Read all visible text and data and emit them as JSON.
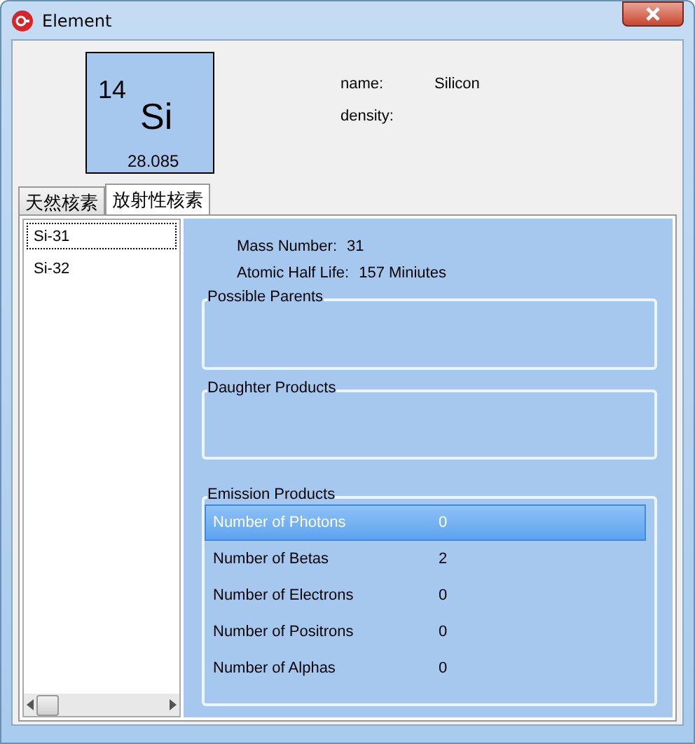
{
  "window": {
    "title": "Element"
  },
  "element": {
    "atomic_number": "14",
    "symbol": "Si",
    "atomic_mass": "28.085"
  },
  "properties": [
    {
      "label": "name:",
      "value": "Silicon"
    },
    {
      "label": "density:"
    }
  ],
  "tabs": [
    {
      "label": "天然核素",
      "selected": false
    },
    {
      "label": "放射性核素",
      "selected": true
    }
  ],
  "isotopes": [
    {
      "label": "Si-31",
      "selected": true
    },
    {
      "label": "Si-32",
      "selected": false
    }
  ],
  "details": [
    {
      "label": "Mass Number:",
      "value": "31"
    },
    {
      "label": "Atomic Half Life:",
      "value": "157 Miniutes"
    }
  ],
  "groups": [
    {
      "title": "Possible Parents"
    },
    {
      "title": "Daughter Products"
    },
    {
      "title": "Emission Products",
      "rows": [
        {
          "label": "Number of Photons",
          "value": "0",
          "selected": true
        },
        {
          "label": "Number of Betas",
          "value": "2",
          "selected": false
        },
        {
          "label": "Number of Electrons",
          "value": "0",
          "selected": false
        },
        {
          "label": "Number of Positrons",
          "value": "0",
          "selected": false
        },
        {
          "label": "Number of Alphas",
          "value": "0",
          "selected": false
        }
      ]
    }
  ]
}
